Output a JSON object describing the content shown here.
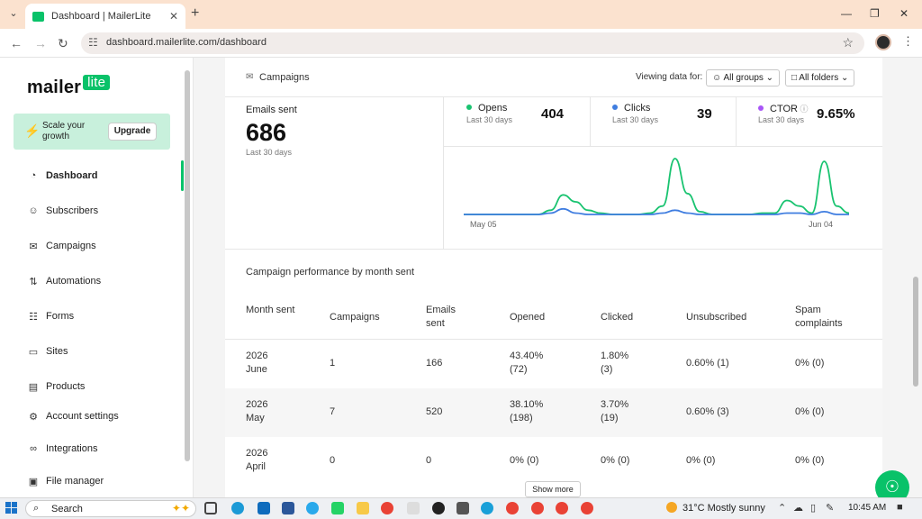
{
  "browser": {
    "tab_title": "Dashboard | MailerLite",
    "url": "dashboard.mailerlite.com/dashboard"
  },
  "sidebar": {
    "logo_text": "mailer",
    "logo_badge": "lite",
    "promo_text": "Scale your growth",
    "upgrade_label": "Upgrade",
    "items": [
      {
        "label": "Dashboard",
        "icon": "dashboard-icon"
      },
      {
        "label": "Subscribers",
        "icon": "user-icon"
      },
      {
        "label": "Campaigns",
        "icon": "mail-icon"
      },
      {
        "label": "Automations",
        "icon": "automation-icon"
      },
      {
        "label": "Forms",
        "icon": "forms-icon"
      },
      {
        "label": "Sites",
        "icon": "sites-icon"
      },
      {
        "label": "Products",
        "icon": "products-icon"
      },
      {
        "label": "Account settings",
        "icon": "gear-icon"
      },
      {
        "label": "Integrations",
        "icon": "link-icon"
      },
      {
        "label": "File manager",
        "icon": "image-icon"
      }
    ]
  },
  "campaigns": {
    "header": "Campaigns",
    "viewing_label": "Viewing data for:",
    "groups_filter": "All groups",
    "folders_filter": "All folders",
    "emails_sent_label": "Emails sent",
    "emails_sent_value": "686",
    "emails_sent_period": "Last 30 days",
    "metrics": [
      {
        "name": "Opens",
        "period": "Last 30 days",
        "value": "404",
        "color": "#19c370"
      },
      {
        "name": "Clicks",
        "period": "Last 30 days",
        "value": "39",
        "color": "#3f7de0"
      },
      {
        "name": "CTOR",
        "period": "Last 30 days",
        "value": "9.65%",
        "color": "#a855f7"
      }
    ]
  },
  "chart_data": {
    "type": "line",
    "x_start_label": "May 05",
    "x_end_label": "Jun 04",
    "series": [
      {
        "name": "Opens",
        "color": "#19c370",
        "values": [
          0,
          0,
          0,
          0,
          0,
          0,
          0,
          3,
          14,
          9,
          3,
          1,
          0,
          0,
          0,
          1,
          6,
          40,
          15,
          2,
          0,
          0,
          0,
          0,
          1,
          1,
          10,
          6,
          1,
          38,
          6,
          1
        ]
      },
      {
        "name": "Clicks",
        "color": "#3f7de0",
        "values": [
          0,
          0,
          0,
          0,
          0,
          0,
          0,
          1,
          4,
          1,
          0,
          0,
          0,
          0,
          0,
          0,
          1,
          3,
          1,
          0,
          0,
          0,
          0,
          0,
          0,
          0,
          1,
          1,
          0,
          2,
          0,
          0
        ]
      }
    ]
  },
  "performance": {
    "title": "Campaign performance by month sent",
    "columns": [
      "Month sent",
      "Campaigns",
      "Emails sent",
      "Opened",
      "Clicked",
      "Unsubscribed",
      "Spam complaints"
    ],
    "rows": [
      {
        "month": "2026 June",
        "campaigns": "1",
        "emails": "166",
        "opened": "43.40% (72)",
        "clicked": "1.80% (3)",
        "unsub": "0.60% (1)",
        "spam": "0% (0)"
      },
      {
        "month": "2026 May",
        "campaigns": "7",
        "emails": "520",
        "opened": "38.10% (198)",
        "clicked": "3.70% (19)",
        "unsub": "0.60% (3)",
        "spam": "0% (0)"
      },
      {
        "month": "2026 April",
        "campaigns": "0",
        "emails": "0",
        "opened": "0% (0)",
        "clicked": "0% (0)",
        "unsub": "0% (0)",
        "spam": "0% (0)"
      }
    ],
    "show_more": "Show more"
  },
  "taskbar": {
    "search_placeholder": "Search",
    "weather": "31°C  Mostly sunny",
    "time": "10:45 AM"
  }
}
